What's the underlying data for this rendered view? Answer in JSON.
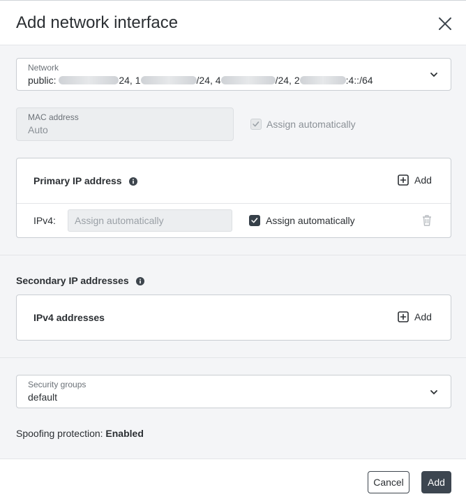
{
  "dialog": {
    "title": "Add network interface"
  },
  "network": {
    "label": "Network",
    "prefix": "public: ",
    "seg1_suffix": "24, ",
    "seg2_lead": "1",
    "seg2_suffix": "/24, ",
    "seg3_lead": "4",
    "seg3_suffix": "/24, ",
    "seg4_lead": "2",
    "seg4_suffix": ":4::/64"
  },
  "mac": {
    "label": "MAC address",
    "value": "Auto",
    "assign_label": "Assign automatically"
  },
  "primary_ip": {
    "title": "Primary IP address",
    "add_label": "Add",
    "row_label": "IPv4:",
    "input_placeholder": "Assign automatically",
    "assign_label": "Assign automatically"
  },
  "secondary_ip": {
    "title": "Secondary IP addresses",
    "card_title": "IPv4 addresses",
    "add_label": "Add"
  },
  "security_groups": {
    "label": "Security groups",
    "value": "default"
  },
  "spoofing": {
    "label": "Spoofing protection: ",
    "value": "Enabled"
  },
  "footer": {
    "cancel_label": "Cancel",
    "add_label": "Add"
  }
}
